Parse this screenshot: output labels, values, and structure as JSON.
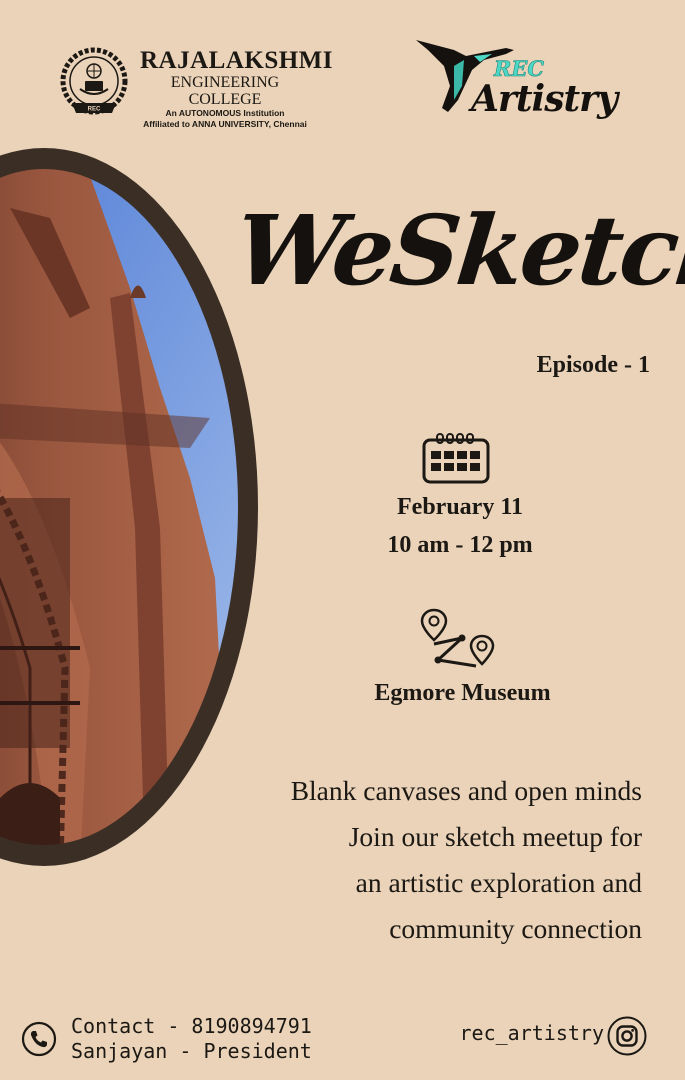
{
  "header": {
    "college_name": "RAJALAKSHMI",
    "college_subtitle": "ENGINEERING COLLEGE",
    "college_line1": "An AUTONOMOUS Institution",
    "college_line2": "Affiliated to ANNA UNIVERSITY, Chennai",
    "college_emblem_text": "REC",
    "club_logo_top": "REC",
    "club_logo_main": "Artistry",
    "club_icon": "hummingbird-icon"
  },
  "event": {
    "title": "WeSketch",
    "episode": "Episode - 1",
    "date": "February 11",
    "time": "10 am - 12 pm",
    "venue": "Egmore Museum"
  },
  "description": {
    "line1": "Blank canvases and open minds",
    "line2": "Join our sketch meetup for",
    "line3": "an artistic exploration and",
    "line4": "community connection"
  },
  "footer": {
    "contact": "Contact - 8190894791",
    "contact_name": "Sanjayan - President",
    "instagram": "rec_artistry",
    "phone_icon": "phone-icon",
    "instagram_icon": "instagram-icon"
  },
  "colors": {
    "background": "#ead3b8",
    "text": "#1c1814",
    "frame": "#3b2e25",
    "sky": "#7da6e6",
    "stone": "#8d4a36",
    "accent_teal": "#4fd7c6"
  }
}
